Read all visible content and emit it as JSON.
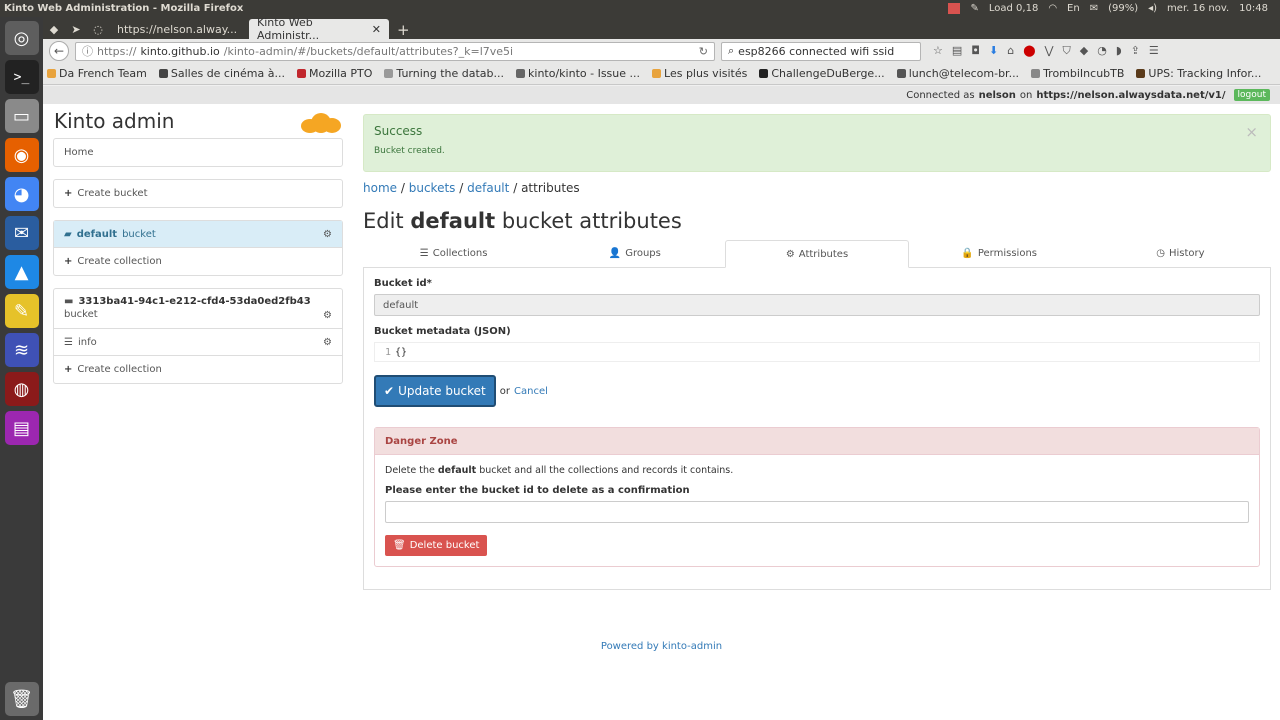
{
  "os": {
    "window_title": "Kinto Web Administration - Mozilla Firefox",
    "load": "Load 0,18",
    "keyboard": "En",
    "battery": "(99%)",
    "clock": "mer. 16 nov.",
    "time": "10:48"
  },
  "browser": {
    "tabs": [
      {
        "label": "https://nelson.alway..."
      },
      {
        "label": "Kinto Web Administr..."
      }
    ],
    "url_prefix": "https://",
    "url_host": "kinto.github.io",
    "url_path": "/kinto-admin/#/buckets/default/attributes?_k=l7ve5i",
    "search_value": "esp8266 connected wifi ssid",
    "bookmarks": [
      "Da French Team",
      "Salles de cinéma à...",
      "Mozilla PTO",
      "Turning the datab...",
      "kinto/kinto - Issue ...",
      "Les plus visités",
      "ChallengeDuBerge...",
      "lunch@telecom-br...",
      "TrombiIncubTB",
      "UPS: Tracking Infor..."
    ]
  },
  "connection": {
    "prefix": "Connected as",
    "user": "nelson",
    "on": "on",
    "server": "https://nelson.alwaysdata.net/v1/",
    "logout": "logout"
  },
  "sidebar": {
    "brand": "Kinto admin",
    "home": "Home",
    "create_bucket": "Create bucket",
    "buckets": [
      {
        "name": "default",
        "suffix": "bucket",
        "create_collection": "Create collection"
      },
      {
        "name": "3313ba41-94c1-e212-cfd4-53da0ed2fb43",
        "suffix": "bucket",
        "collection": "info",
        "create_collection": "Create collection"
      }
    ]
  },
  "alert": {
    "title": "Success",
    "message": "Bucket created.",
    "close": "×"
  },
  "breadcrumb": {
    "home": "home",
    "buckets": "buckets",
    "default": "default",
    "current": "attributes",
    "sep": "/"
  },
  "heading": {
    "pre": "Edit",
    "bucket": "default",
    "post": "bucket attributes"
  },
  "tabs": [
    "Collections",
    "Groups",
    "Attributes",
    "Permissions",
    "History"
  ],
  "form": {
    "bucket_id_label": "Bucket id*",
    "bucket_id_value": "default",
    "metadata_label": "Bucket metadata (JSON)",
    "metadata_line_no": "1",
    "metadata_value": "{}",
    "submit": "Update bucket",
    "or": "or",
    "cancel": "Cancel"
  },
  "danger": {
    "title": "Danger Zone",
    "text_pre": "Delete the",
    "text_bold": "default",
    "text_post": "bucket and all the collections and records it contains.",
    "confirm_label": "Please enter the bucket id to delete as a confirmation",
    "delete_button": "Delete bucket"
  },
  "footer": "Powered by kinto-admin"
}
